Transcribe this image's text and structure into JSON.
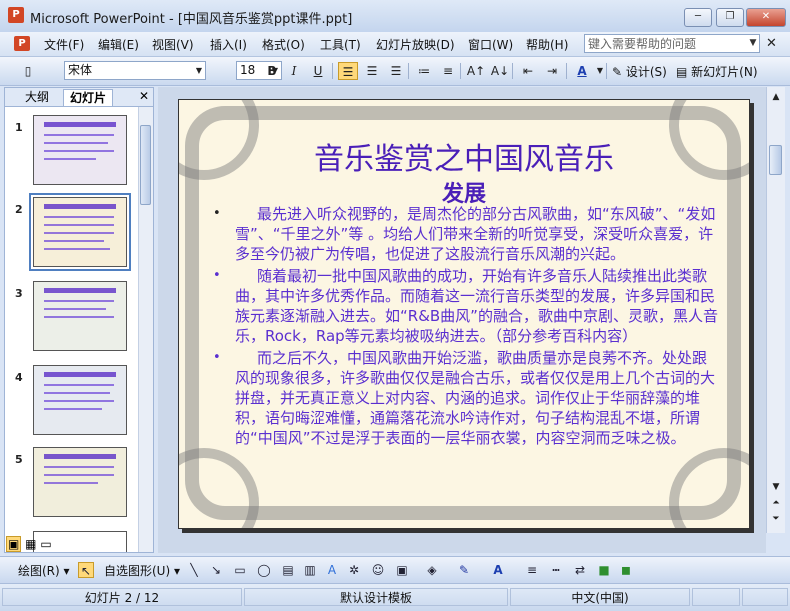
{
  "window": {
    "title": "Microsoft PowerPoint - [中国风音乐鉴赏ppt课件.ppt]",
    "minimize": "─",
    "restore": "❐",
    "close": "✕"
  },
  "menu": {
    "items": [
      "文件(F)",
      "编辑(E)",
      "视图(V)",
      "插入(I)",
      "格式(O)",
      "工具(T)",
      "幻灯片放映(D)",
      "窗口(W)",
      "帮助(H)"
    ],
    "help_placeholder": "键入需要帮助的问题",
    "close": "✕"
  },
  "toolbar": {
    "font": "宋体",
    "size": "18",
    "bold": "B",
    "italic": "I",
    "underline": "U",
    "design_label": "设计(S)",
    "new_slide_label": "新幻灯片(N)"
  },
  "left_pane": {
    "tabs": [
      "大纲",
      "幻灯片"
    ],
    "close": "✕",
    "thumbnails": [
      {
        "num": "1",
        "bg": "#ece7f2"
      },
      {
        "num": "2",
        "bg": "#f6efd9"
      },
      {
        "num": "3",
        "bg": "#ecefe8"
      },
      {
        "num": "4",
        "bg": "#e6eaf0"
      },
      {
        "num": "5",
        "bg": "#f1eedc"
      }
    ],
    "selected_index": 2
  },
  "slide": {
    "title": "音乐鉴赏之中国风音乐",
    "subtitle": "发展",
    "bullets": [
      "最先进入听众视野的，是周杰伦的部分古风歌曲，如“东风破”、“发如雪”、“千里之外”等 。均给人们带来全新的听觉享受，深受听众喜爱，许多至今仍被广为传唱，也促进了这股流行音乐风潮的兴起。",
      "随着最初一批中国风歌曲的成功，开始有许多音乐人陆续推出此类歌曲，其中许多优秀作品。而随着这一流行音乐类型的发展，许多异国和民族元素逐渐融入进去。如“R&B曲风”的融合，歌曲中京剧、灵歌，黑人音乐，Rock，Rap等元素均被吸纳进去。（部分参考百科内容）",
      "而之后不久，中国风歌曲开始泛滥，歌曲质量亦是良莠不齐。处处跟风的现象很多，许多歌曲仅仅是融合古乐，或者仅仅是用上几个古词的大拼盘，并无真正意义上对内容、内涵的追求。词作仅止于华丽辞藻的堆积，语句晦涩难懂，通篇落花流水吟诗作对，句子结构混乱不堪，所谓的“中国风”不过是浮于表面的一层华丽衣裳，内容空洞而乏味之极。"
    ],
    "colors": {
      "text": "#5a2fd0",
      "title": "#4a1fb8"
    }
  },
  "drawing_toolbar": {
    "draw_label": "绘图(R)",
    "autoshapes_label": "自选图形(U)"
  },
  "status": {
    "slide_info": "幻灯片 2 / 12",
    "template": "默认设计模板",
    "language": "中文(中国)"
  }
}
